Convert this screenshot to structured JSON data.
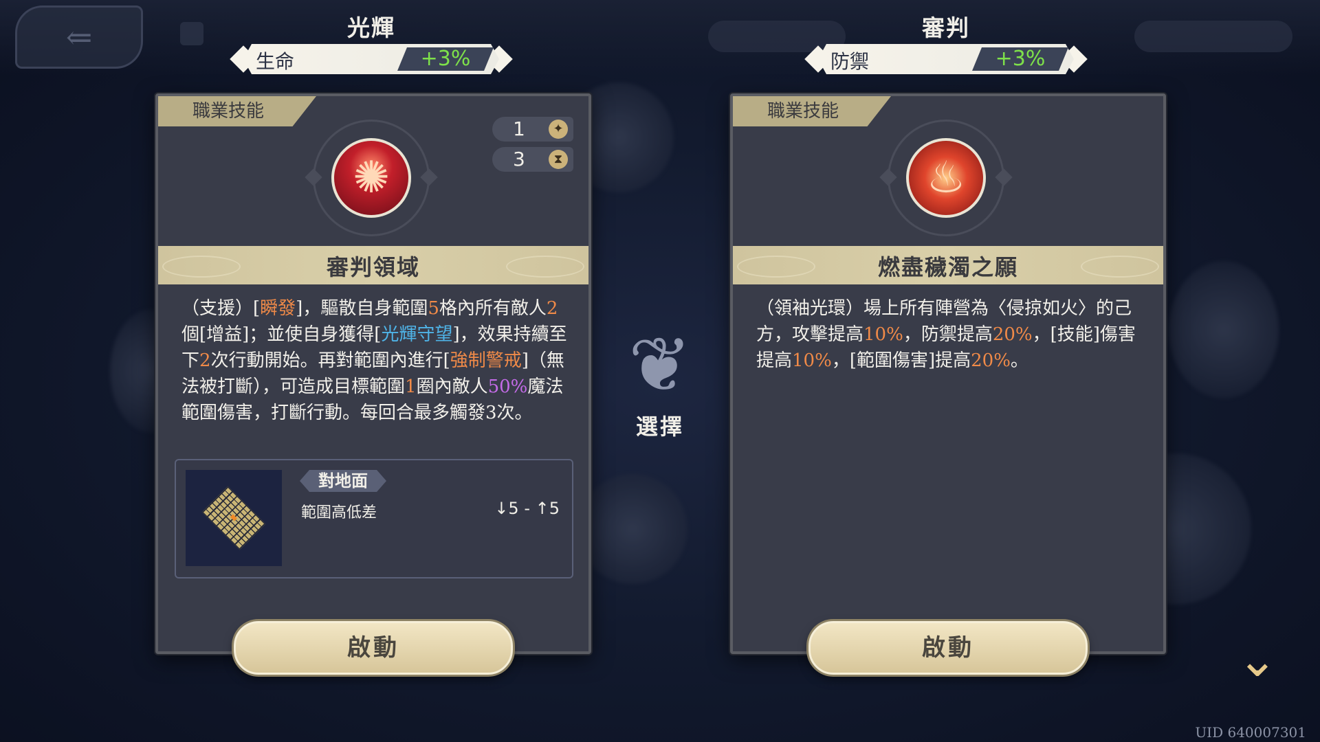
{
  "header": {
    "left": {
      "title": "光輝",
      "stat_label": "生命",
      "stat_value": "+3%"
    },
    "right": {
      "title": "審判",
      "stat_label": "防禦",
      "stat_value": "+3%"
    }
  },
  "left_card": {
    "tag": "職業技能",
    "emblem_icon": "red-hands-orb-icon",
    "counters": [
      {
        "value": "1",
        "icon": "star-icon"
      },
      {
        "value": "3",
        "icon": "hourglass-icon"
      }
    ],
    "skill_name": "審判領域",
    "description_segments": [
      {
        "t": "（支援）[",
        "c": ""
      },
      {
        "t": "瞬發",
        "c": "o"
      },
      {
        "t": "]，驅散自身範圍",
        "c": ""
      },
      {
        "t": "5",
        "c": "o"
      },
      {
        "t": "格內所有敵人",
        "c": ""
      },
      {
        "t": "2",
        "c": "o"
      },
      {
        "t": "個[增益]；並使自身獲得[",
        "c": ""
      },
      {
        "t": "光輝守望",
        "c": "b"
      },
      {
        "t": "]，效果持續至下",
        "c": ""
      },
      {
        "t": "2",
        "c": "o"
      },
      {
        "t": "次行動開始。再對範圍內進行[",
        "c": ""
      },
      {
        "t": "強制警戒",
        "c": "o"
      },
      {
        "t": "]（無法被打斷），可造成目標範圍",
        "c": ""
      },
      {
        "t": "1",
        "c": "o"
      },
      {
        "t": "圈內敵人",
        "c": ""
      },
      {
        "t": "50%",
        "c": "p"
      },
      {
        "t": "魔法範圍傷害，打斷行動。每回合最多觸發3次。",
        "c": ""
      }
    ],
    "range": {
      "tag": "對地面",
      "label": "範圍高低差",
      "value": "↓5 - ↑5"
    },
    "activate_label": "啟動"
  },
  "right_card": {
    "tag": "職業技能",
    "emblem_icon": "flame-swirl-orb-icon",
    "skill_name": "燃盡穢濁之願",
    "description_segments": [
      {
        "t": "（領袖光環）場上所有陣營為〈侵掠如火〉的己方，攻擊提高",
        "c": ""
      },
      {
        "t": "10%",
        "c": "o"
      },
      {
        "t": "，防禦提高",
        "c": ""
      },
      {
        "t": "20%",
        "c": "o"
      },
      {
        "t": "，[技能]傷害提高",
        "c": ""
      },
      {
        "t": "10%",
        "c": "o"
      },
      {
        "t": "，[範圍傷害]提高",
        "c": ""
      },
      {
        "t": "20%",
        "c": "o"
      },
      {
        "t": "。",
        "c": ""
      }
    ],
    "activate_label": "啟動"
  },
  "center": {
    "select_label": "選擇",
    "icon": "tree-emblem-icon"
  },
  "footer": {
    "uid": "UID 640007301",
    "expand_icon": "chevron-down-icon"
  },
  "colors": {
    "accent_gold": "#d7c69a",
    "highlight_orange": "#f08a48",
    "highlight_blue": "#4fb4e8",
    "highlight_purple": "#c46be8",
    "stat_green": "#7ee14a"
  }
}
